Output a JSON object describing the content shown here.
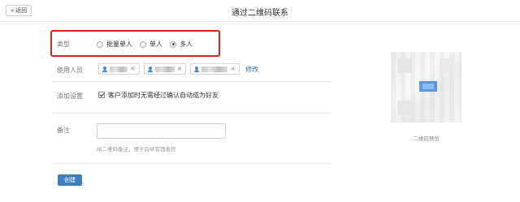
{
  "topbar": {
    "back_label": "返回",
    "title": "通过二维码联系"
  },
  "form": {
    "type": {
      "label": "类型",
      "options": [
        {
          "label": "批量单人",
          "selected": false
        },
        {
          "label": "单人",
          "selected": false
        },
        {
          "label": "多人",
          "selected": true
        }
      ]
    },
    "users": {
      "label": "使用人员",
      "tag_count": 3,
      "edit_label": "修改"
    },
    "add_setting": {
      "label": "添加设置",
      "checked": true,
      "text": "客户添加时无需经过确认自动成为好友"
    },
    "remark": {
      "label": "备注",
      "value": "",
      "placeholder": "",
      "hint": "给二维码备注，便于后续管理查找"
    },
    "create_label": "创建"
  },
  "preview": {
    "label": "二维码预览"
  },
  "colors": {
    "highlight_border": "#d9201c",
    "accent": "#3d7fc1",
    "link": "#2f6fb5"
  }
}
